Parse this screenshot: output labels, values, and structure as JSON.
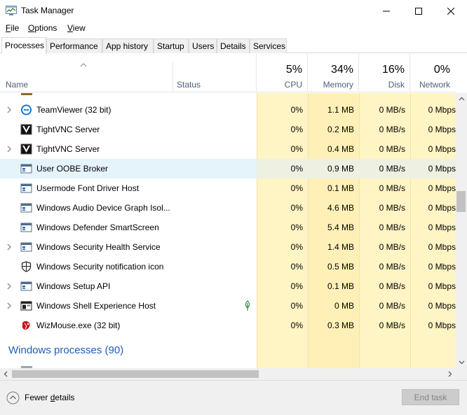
{
  "window": {
    "title": "Task Manager",
    "app_icon": "task-manager-icon"
  },
  "menu": [
    {
      "label": "File",
      "mnemonic": "F",
      "rest": "ile"
    },
    {
      "label": "Options",
      "mnemonic": "O",
      "rest": "ptions"
    },
    {
      "label": "View",
      "mnemonic": "V",
      "rest": "iew"
    }
  ],
  "tabs": [
    "Processes",
    "Performance",
    "App history",
    "Startup",
    "Users",
    "Details",
    "Services"
  ],
  "active_tab": "Processes",
  "columns": {
    "name": "Name",
    "status": "Status",
    "cpu": {
      "pct": "5%",
      "label": "CPU"
    },
    "memory": {
      "pct": "34%",
      "label": "Memory"
    },
    "disk": {
      "pct": "16%",
      "label": "Disk"
    },
    "network": {
      "pct": "0%",
      "label": "Network"
    }
  },
  "processes": [
    {
      "name": "TeamViewer (32 bit)",
      "icon": "teamviewer-icon",
      "expandable": true,
      "cpu": "0%",
      "memory": "1.1 MB",
      "disk": "0 MB/s",
      "network": "0 Mbps"
    },
    {
      "name": "TightVNC Server",
      "icon": "tightvnc-icon",
      "expandable": false,
      "cpu": "0%",
      "memory": "0.2 MB",
      "disk": "0 MB/s",
      "network": "0 Mbps"
    },
    {
      "name": "TightVNC Server",
      "icon": "tightvnc-icon",
      "expandable": true,
      "cpu": "0%",
      "memory": "0.4 MB",
      "disk": "0 MB/s",
      "network": "0 Mbps"
    },
    {
      "name": "User OOBE Broker",
      "icon": "window-app-icon",
      "expandable": false,
      "selected": true,
      "cpu": "0%",
      "memory": "0.9 MB",
      "disk": "0 MB/s",
      "network": "0 Mbps"
    },
    {
      "name": "Usermode Font Driver Host",
      "icon": "window-app-icon",
      "expandable": false,
      "cpu": "0%",
      "memory": "0.1 MB",
      "disk": "0 MB/s",
      "network": "0 Mbps"
    },
    {
      "name": "Windows Audio Device Graph Isol...",
      "icon": "window-app-icon",
      "expandable": false,
      "cpu": "0%",
      "memory": "4.6 MB",
      "disk": "0 MB/s",
      "network": "0 Mbps"
    },
    {
      "name": "Windows Defender SmartScreen",
      "icon": "window-app-icon",
      "expandable": false,
      "cpu": "0%",
      "memory": "5.4 MB",
      "disk": "0 MB/s",
      "network": "0 Mbps"
    },
    {
      "name": "Windows Security Health Service",
      "icon": "window-app-icon",
      "expandable": true,
      "cpu": "0%",
      "memory": "1.4 MB",
      "disk": "0 MB/s",
      "network": "0 Mbps"
    },
    {
      "name": "Windows Security notification icon",
      "icon": "shield-icon",
      "expandable": false,
      "cpu": "0%",
      "memory": "0.5 MB",
      "disk": "0 MB/s",
      "network": "0 Mbps"
    },
    {
      "name": "Windows Setup API",
      "icon": "window-app-icon",
      "expandable": true,
      "cpu": "0%",
      "memory": "0.1 MB",
      "disk": "0 MB/s",
      "network": "0 Mbps"
    },
    {
      "name": "Windows Shell Experience Host",
      "icon": "shell-host-icon",
      "expandable": true,
      "status_icon": "suspended-leaf-icon",
      "cpu": "0%",
      "memory": "0 MB",
      "disk": "0 MB/s",
      "network": "0 Mbps"
    },
    {
      "name": "WizMouse.exe (32 bit)",
      "icon": "wizmouse-icon",
      "expandable": false,
      "cpu": "0%",
      "memory": "0.3 MB",
      "disk": "0 MB/s",
      "network": "0 Mbps"
    }
  ],
  "group": {
    "title": "Windows processes (90)"
  },
  "footer": {
    "fewer_details": "Fewer details",
    "fewer_prefix": "Fewer ",
    "fewer_mnemonic": "d",
    "fewer_suffix": "etails",
    "end_task": "End task"
  },
  "colors": {
    "accent_group": "#1e5db3",
    "heat_light": "#fff4c4",
    "heat_mem": "#fff0b8",
    "selection": "#e5f3fb"
  }
}
